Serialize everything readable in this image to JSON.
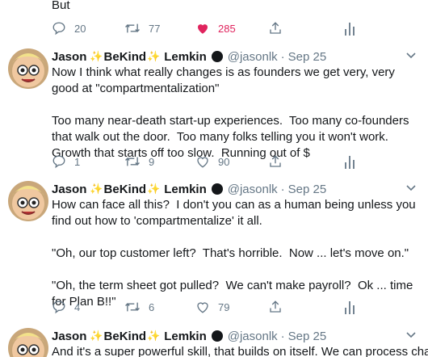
{
  "prev_tweet": {
    "text_tail": "But",
    "replies": "20",
    "retweets": "77",
    "likes": "285"
  },
  "tweets": [
    {
      "name_first": "Jason",
      "sparkle": "✨",
      "name_mid": "BeKind",
      "name_last": "Lemkin",
      "handle": "@jasonlk",
      "separator": "·",
      "date": "Sep 25",
      "text": "Now I think what really changes is as founders we get very, very good at \"compartmentalization\"\n\nToo many near-death start-up experiences.  Too many co-founders that walk out the door.  Too many folks telling you it won't work.  Growth that starts off too slow.  Running out of $",
      "replies": "1",
      "retweets": "9",
      "likes": "90"
    },
    {
      "name_first": "Jason",
      "sparkle": "✨",
      "name_mid": "BeKind",
      "name_last": "Lemkin",
      "handle": "@jasonlk",
      "separator": "·",
      "date": "Sep 25",
      "text": "How can face all this?  I don't you can as a human being unless you find out how to 'compartmentalize' it all.\n\n\"Oh, our top customer left?  That's horrible.  Now ... let's move on.\"\n\n\"Oh, the term sheet got pulled?  We can't make payroll?  Ok ... time for Plan B!!\"",
      "replies": "4",
      "retweets": "6",
      "likes": "79"
    },
    {
      "name_first": "Jason",
      "sparkle": "✨",
      "name_mid": "BeKind",
      "name_last": "Lemkin",
      "handle": "@jasonlk",
      "separator": "·",
      "date": "Sep 25",
      "text": "And it's a super powerful skill, that builds on itself.  We can process change"
    }
  ],
  "colors": {
    "text": "#14171a",
    "muted": "#657786",
    "like": "#e0245e",
    "sparkle": "#f5b400"
  }
}
